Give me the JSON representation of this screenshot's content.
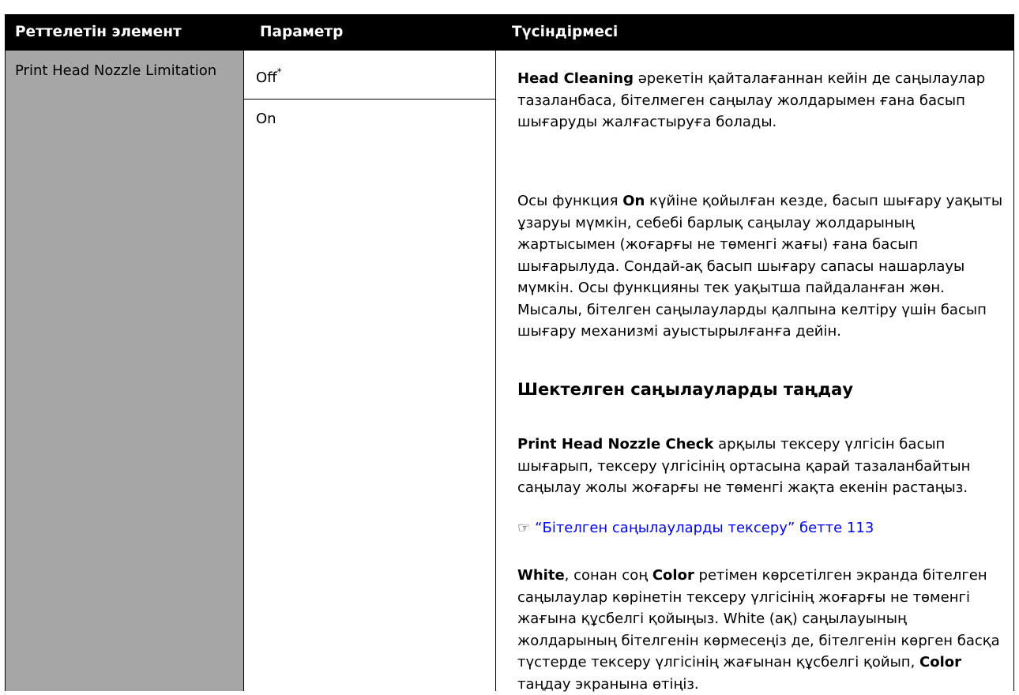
{
  "header": {
    "col1": "Реттелетін элемент",
    "col2": "Параметр",
    "col3": "Түсіндірмесі"
  },
  "row": {
    "item": "Print Head Nozzle Limitation",
    "params": [
      {
        "label": "Off",
        "mark": "*"
      },
      {
        "label": "On"
      }
    ],
    "desc": {
      "p1_bold": "Head Cleaning",
      "p1_rest": " әрекетін қайталағаннан кейін де саңылаулар тазаланбаса, бітелмеген саңылау жолдарымен ғана басып шығаруды жалғастыруға болады.",
      "p2_pre": "Осы функция ",
      "p2_bold": "On",
      "p2_rest": " күйіне қойылған кезде, басып шығару уақыты ұзаруы мүмкін, себебі барлық саңылау жолдарының жартысымен (жоғарғы не төменгі жағы) ғана басып шығарылуда. Сондай-ақ басып шығару сапасы нашарлауы мүмкін. Осы функцияны тек уақытша пайдаланған жөн. Мысалы, бітелген саңылауларды қалпына келтіру үшін басып шығару механизмі ауыстырылғанға дейін.",
      "heading": "Шектелген саңылауларды таңдау",
      "p3_bold": "Print Head Nozzle Check",
      "p3_rest": " арқылы тексеру үлгісін басып шығарып, тексеру үлгісінің ортасына қарай тазаланбайтын саңылау жолы жоғарғы не төменгі жақта екенін растаңыз.",
      "link_icon": "pointing-hand-icon",
      "link_text": "“Бітелген саңылауларды тексеру” бетте 113",
      "p4_bold1": "White",
      "p4_mid1": ", сонан соң ",
      "p4_bold2": "Color",
      "p4_mid2": " ретімен көрсетілген экранда бітелген саңылаулар көрінетін тексеру үлгісінің жоғарғы не төменгі жағына құсбелгі қойыңыз. White (ақ) саңылауының жолдарының бітелгенін көрмесеңіз де, бітелгенін көрген басқа түстерде тексеру үлгісінің жағынан құсбелгі қойып, ",
      "p4_bold3": "Color",
      "p4_end": " таңдау экранына өтіңіз."
    }
  },
  "colors": {
    "header_bg": "#000000",
    "item_bg": "#a6a6a6",
    "link": "#0000ff"
  }
}
